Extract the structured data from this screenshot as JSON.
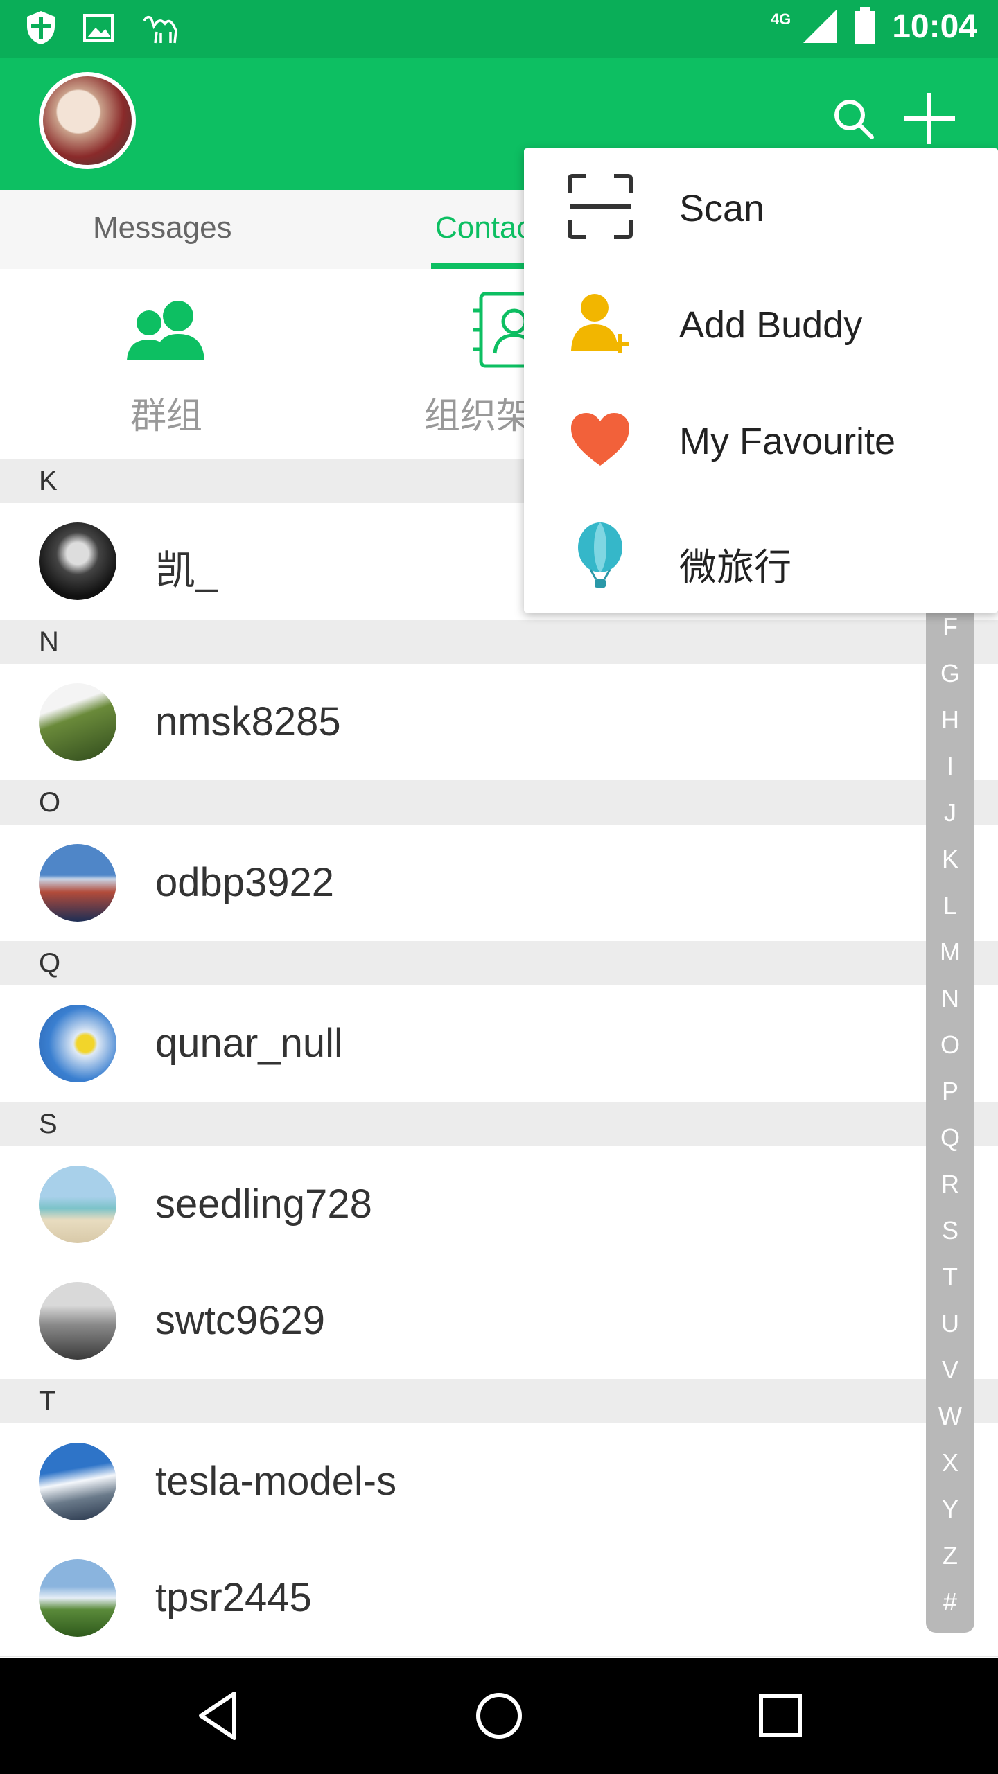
{
  "status_bar": {
    "network": "4G",
    "time": "10:04"
  },
  "app_bar": {
    "search_icon": "search-icon",
    "add_icon": "plus-icon",
    "colors": {
      "primary": "#0dbf62",
      "status": "#0aae58"
    }
  },
  "tabs": [
    {
      "label": "Messages"
    },
    {
      "label": "Contac"
    }
  ],
  "shortcuts": [
    {
      "label": "群组",
      "icon": "group-icon"
    },
    {
      "label": "组织架",
      "icon": "org-chart-icon"
    }
  ],
  "sections": [
    {
      "letter": "K",
      "contacts": [
        {
          "name": "凯_"
        }
      ]
    },
    {
      "letter": "N",
      "contacts": [
        {
          "name": "nmsk8285"
        }
      ]
    },
    {
      "letter": "O",
      "contacts": [
        {
          "name": "odbp3922"
        }
      ]
    },
    {
      "letter": "Q",
      "contacts": [
        {
          "name": "qunar_null"
        }
      ]
    },
    {
      "letter": "S",
      "contacts": [
        {
          "name": "seedling728"
        },
        {
          "name": "swtc9629"
        }
      ]
    },
    {
      "letter": "T",
      "contacts": [
        {
          "name": "tesla-model-s"
        },
        {
          "name": "tpsr2445"
        }
      ]
    }
  ],
  "index_letters": [
    "F",
    "G",
    "H",
    "I",
    "J",
    "K",
    "L",
    "M",
    "N",
    "O",
    "P",
    "Q",
    "R",
    "S",
    "T",
    "U",
    "V",
    "W",
    "X",
    "Y",
    "Z",
    "#"
  ],
  "menu": [
    {
      "label": "Scan",
      "icon": "scan-icon"
    },
    {
      "label": "Add Buddy",
      "icon": "add-buddy-icon"
    },
    {
      "label": "My Favourite",
      "icon": "heart-icon"
    },
    {
      "label": "微旅行",
      "icon": "balloon-icon"
    }
  ]
}
